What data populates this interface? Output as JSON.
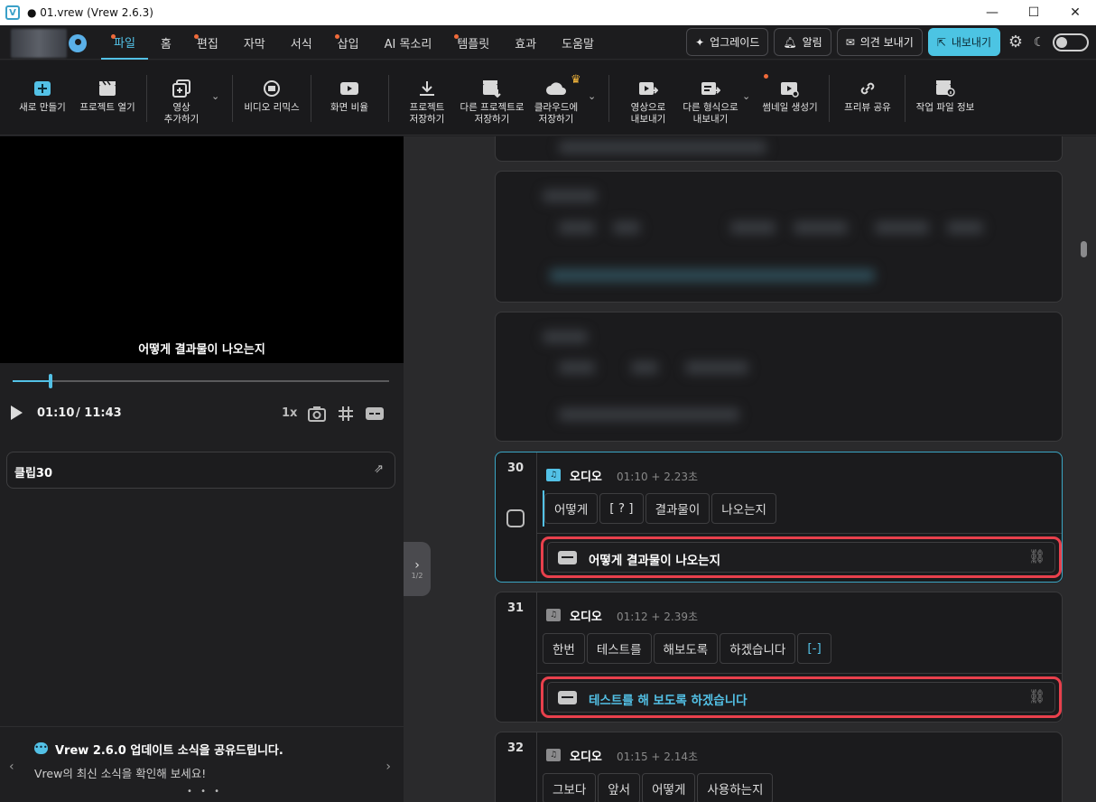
{
  "window": {
    "title": "● 01.vrew (Vrew 2.6.3)",
    "app_icon": "V"
  },
  "menubar": {
    "items": [
      "파일",
      "홈",
      "편집",
      "자막",
      "서식",
      "삽입",
      "AI 목소리",
      "템플릿",
      "효과",
      "도움말"
    ],
    "upgrade_label": "업그레이드",
    "notice_label": "알림",
    "feedback_label": "의견 보내기",
    "export_label": "내보내기"
  },
  "toolbar": {
    "new_label": "새로 만들기",
    "open_label": "프로젝트 열기",
    "add_video_line1": "영상",
    "add_video_line2": "추가하기",
    "remix_label": "비디오 리믹스",
    "ratio_label": "화면 비율",
    "save_line1": "프로젝트",
    "save_line2": "저장하기",
    "saveas_line1": "다른 프로젝트로",
    "saveas_line2": "저장하기",
    "cloud_line1": "클라우드에",
    "cloud_line2": "저장하기",
    "export_video_line1": "영상으로",
    "export_video_line2": "내보내기",
    "export_other_line1": "다른 형식으로",
    "export_other_line2": "내보내기",
    "thumbnail_label": "썸네일 생성기",
    "preview_share_label": "프리뷰 공유",
    "file_info_label": "작업 파일 정보"
  },
  "player": {
    "subtitle": "어떻게 결과물이 나오는지",
    "current_time": "01:10",
    "duration": "/ 11:43",
    "speed": "1x",
    "progress_fraction": 0.1
  },
  "clip_panel": {
    "title": "클립30"
  },
  "news": {
    "title": "Vrew 2.6.0 업데이트 소식을 공유드립니다.",
    "subtitle": "Vrew의 최신 소식을 확인해 보세요!",
    "dots": "• • •"
  },
  "splitter": {
    "fraction": "1/2"
  },
  "clips": [
    {
      "number": "30",
      "type": "오디오",
      "time": "01:10 + 2.23초",
      "words": [
        "어떻게",
        "[ ? ]",
        "결과물이",
        "나오는지"
      ],
      "subtitle": "어떻게 결과물이 나오는지"
    },
    {
      "number": "31",
      "type": "오디오",
      "time": "01:12 + 2.39초",
      "words": [
        "한번",
        "테스트를",
        "해보도록",
        "하겠습니다",
        "[-]"
      ],
      "subtitle": "테스트를 해 보도록 하겠습니다"
    },
    {
      "number": "32",
      "type": "오디오",
      "time": "01:15 + 2.14초",
      "words": [
        "그보다",
        "앞서",
        "어떻게",
        "사용하는지"
      ]
    }
  ],
  "colors": {
    "accent": "#53c1e6",
    "highlight": "#e8404c",
    "notify_dot": "#f06a3a",
    "crown": "#f5b73b"
  }
}
